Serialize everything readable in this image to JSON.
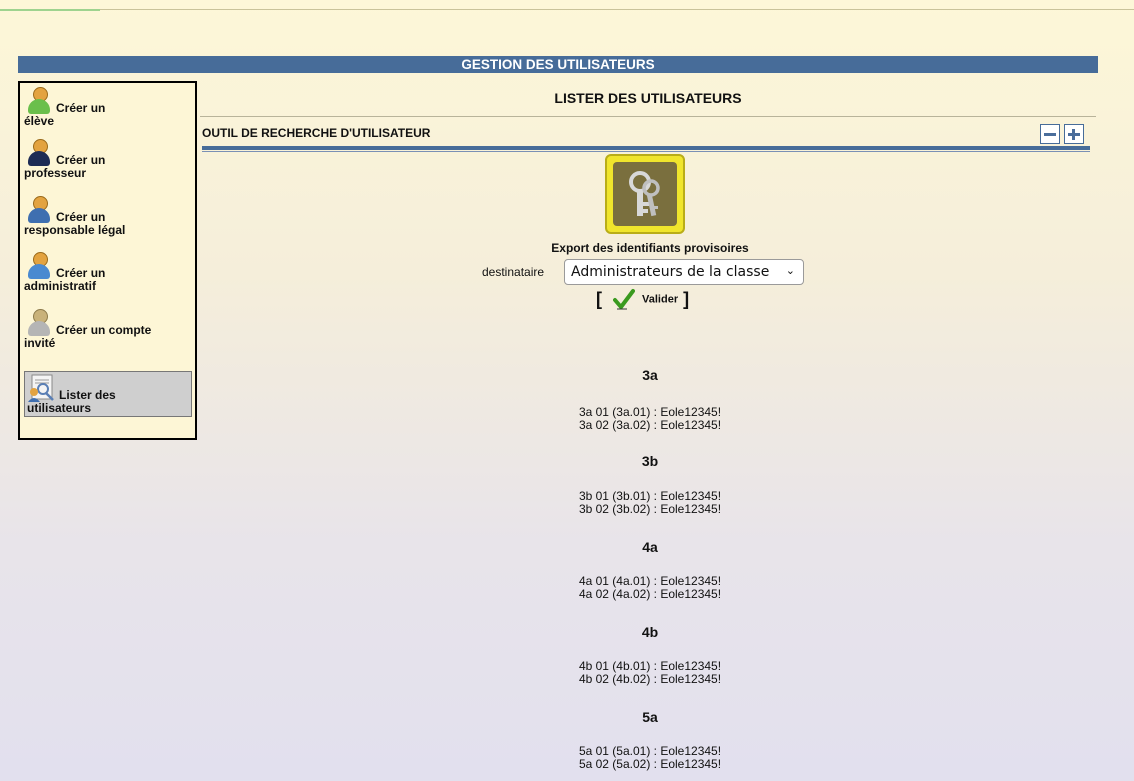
{
  "header": {
    "title": "GESTION DES UTILISATEURS"
  },
  "sidebar": {
    "items": [
      {
        "first": "Créer un",
        "second": "élève",
        "icon": "student-icon",
        "color": "#6abf4b"
      },
      {
        "first": "Créer un",
        "second": "professeur",
        "icon": "teacher-icon",
        "color": "#1d2c55"
      },
      {
        "first": "Créer un",
        "second": "responsable légal",
        "icon": "parent-icon",
        "color": "#3f6fb0"
      },
      {
        "first": "Créer un",
        "second": "administratif",
        "icon": "admin-icon",
        "color": "#4a8ad0"
      },
      {
        "first": "Créer un compte",
        "second": "invité",
        "icon": "guest-icon",
        "color": "#b5b5b5"
      },
      {
        "first": "Lister des",
        "second": "utilisateurs",
        "icon": "list-users-icon",
        "color": "#3f6fb0",
        "active": true
      }
    ]
  },
  "main": {
    "title": "LISTER DES UTILISATEURS",
    "search_tool_label": "OUTIL DE RECHERCHE D'UTILISATEUR",
    "export_title": "Export des identifiants provisoires",
    "dest_label": "destinataire",
    "dest_selected": "Administrateurs de la classe",
    "bracket_open": "[",
    "bracket_close": "]",
    "validate_label": "Valider"
  },
  "classes": [
    {
      "name": "3a",
      "lines": [
        "3a 01 (3a.01) : Eole12345!",
        "3a 02 (3a.02) : Eole12345!"
      ]
    },
    {
      "name": "3b",
      "lines": [
        "3b 01 (3b.01) : Eole12345!",
        "3b 02 (3b.02) : Eole12345!"
      ]
    },
    {
      "name": "4a",
      "lines": [
        "4a 01 (4a.01) : Eole12345!",
        "4a 02 (4a.02) : Eole12345!"
      ]
    },
    {
      "name": "4b",
      "lines": [
        "4b 01 (4b.01) : Eole12345!",
        "4b 02 (4b.02) : Eole12345!"
      ]
    },
    {
      "name": "5a",
      "lines": [
        "5a 01 (5a.01) : Eole12345!",
        "5a 02 (5a.02) : Eole12345!"
      ]
    }
  ],
  "colors": {
    "accent": "#476c99",
    "key_box": "#f0e52c"
  }
}
